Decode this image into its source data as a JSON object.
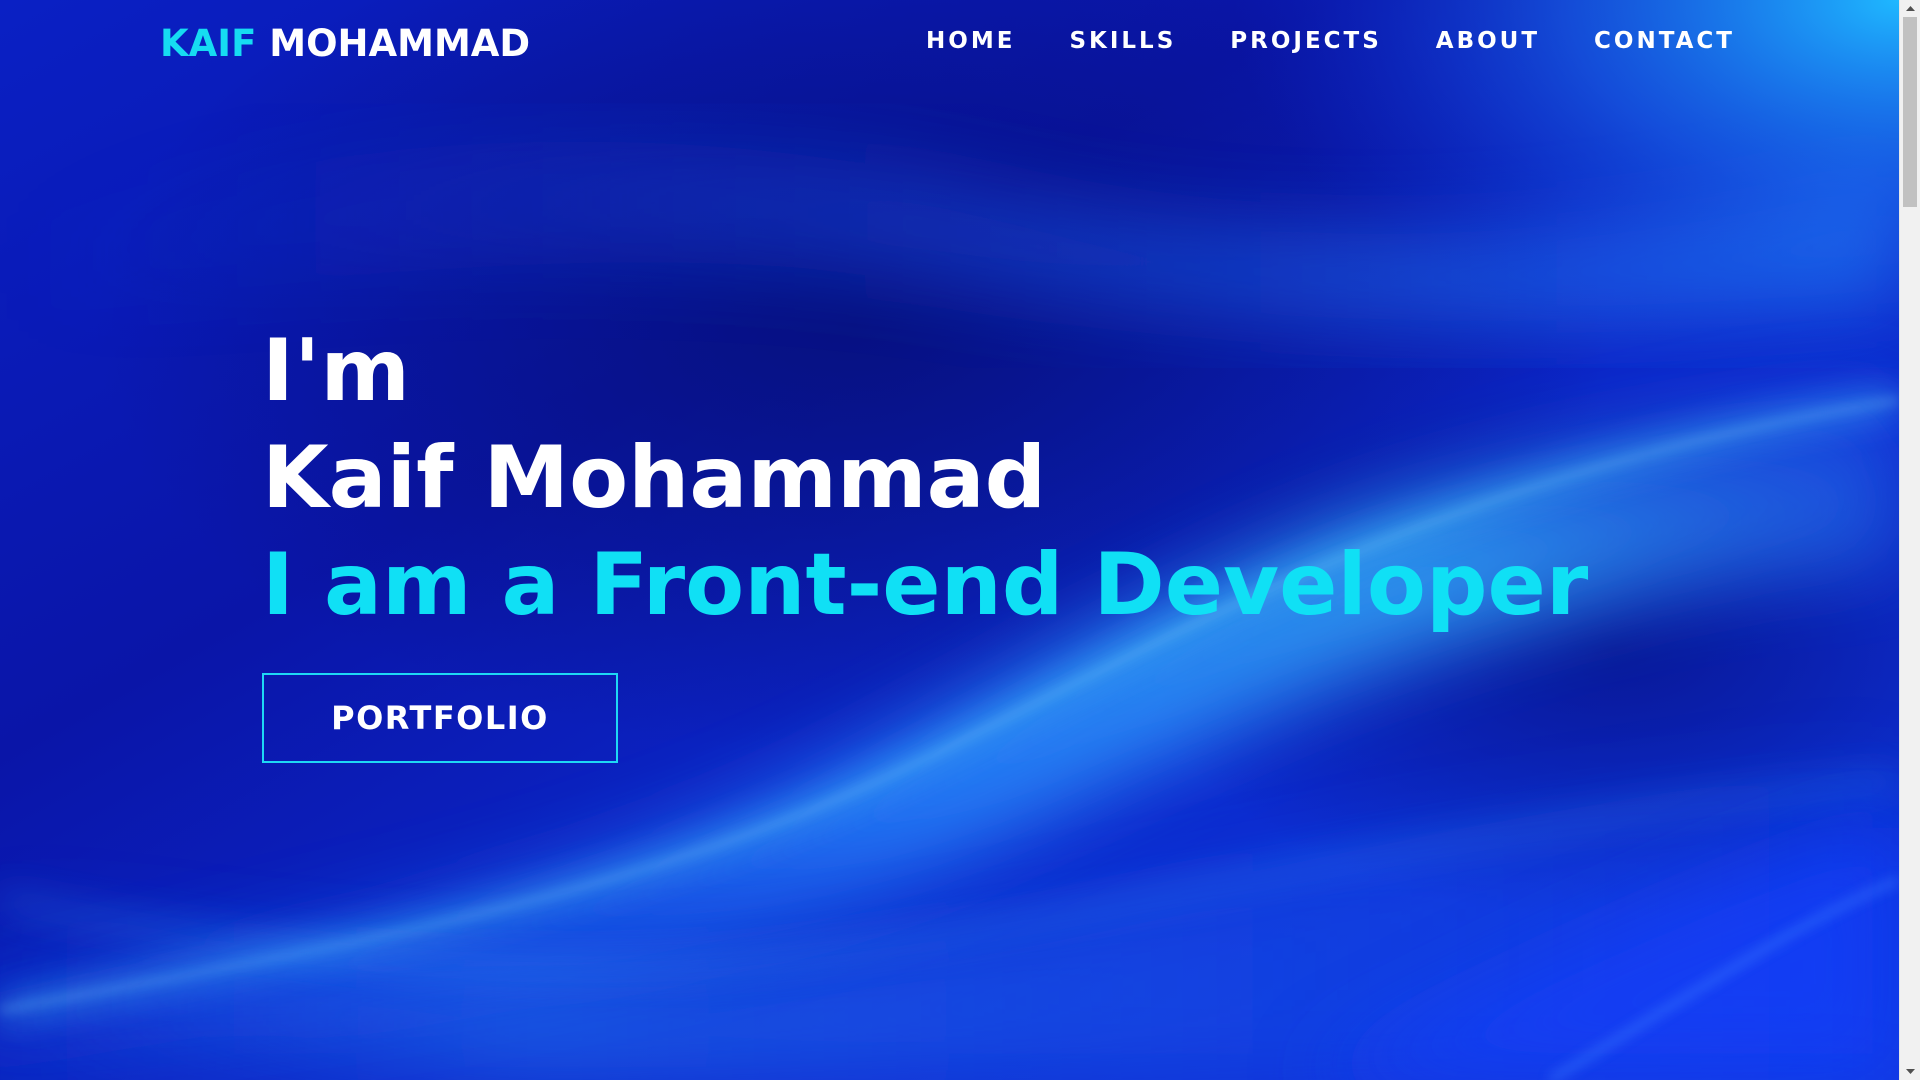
{
  "header": {
    "logo_first": "KAIF",
    "logo_second": "MOHAMMAD",
    "nav": [
      {
        "label": "HOME"
      },
      {
        "label": "SKILLS"
      },
      {
        "label": "PROJECTS"
      },
      {
        "label": "ABOUT"
      },
      {
        "label": "CONTACT"
      }
    ]
  },
  "hero": {
    "greeting": "I'm",
    "name": "Kaif Mohammad",
    "role": "I am a Front-end Developer",
    "cta_label": "PORTFOLIO"
  },
  "scrollbar": {
    "position_fraction": 0.0
  },
  "colors": {
    "accent": "#16dcf2",
    "background": "#0a1fb8",
    "text": "#ffffff",
    "scroll_thumb": "#c1c1c1"
  },
  "icons": {
    "scroll_up": "scroll-up-arrow-icon",
    "scroll_down": "scroll-down-arrow-icon"
  }
}
